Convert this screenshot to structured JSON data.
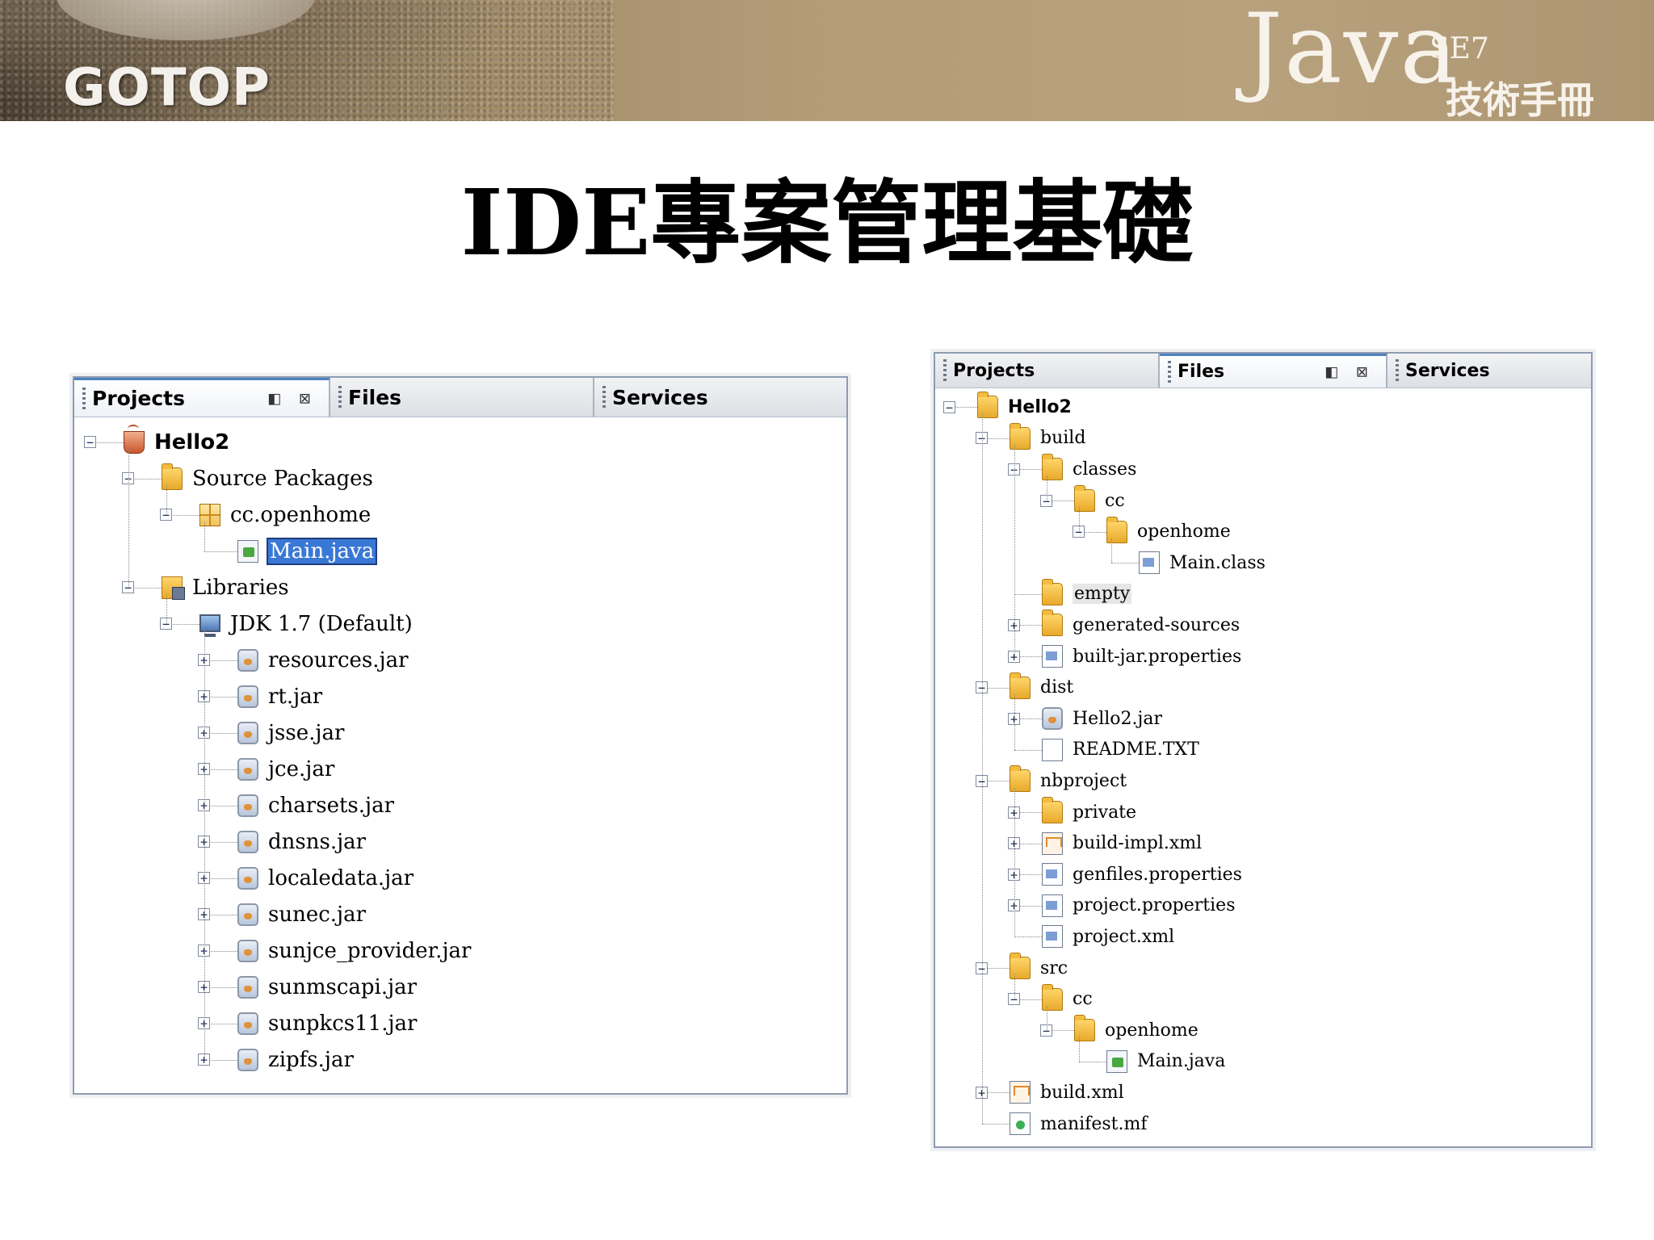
{
  "header": {
    "logo": "GOTOP",
    "java_word": "Java",
    "java_se": "SE7",
    "java_subtitle": "技術手冊"
  },
  "slide": {
    "title": "IDE專案管理基礎"
  },
  "left_panel": {
    "tabs": [
      {
        "label": "Projects",
        "active": true,
        "controls": "◧ ⊠"
      },
      {
        "label": "Files",
        "active": false
      },
      {
        "label": "Services",
        "active": false
      }
    ],
    "tree": [
      {
        "label": "Hello2",
        "icon": "java-project-icon",
        "depth": 0,
        "toggle": "-",
        "bold": true
      },
      {
        "label": "Source Packages",
        "icon": "source-packages-icon",
        "depth": 1,
        "toggle": "-"
      },
      {
        "label": "cc.openhome",
        "icon": "package-icon",
        "depth": 2,
        "toggle": "-"
      },
      {
        "label": "Main.java",
        "icon": "java-file-icon",
        "depth": 3,
        "selected": true
      },
      {
        "label": "Libraries",
        "icon": "libraries-icon",
        "depth": 1,
        "toggle": "-"
      },
      {
        "label": "JDK 1.7 (Default)",
        "icon": "jdk-icon",
        "depth": 2,
        "toggle": "-"
      },
      {
        "label": "resources.jar",
        "icon": "jar-icon",
        "depth": 3,
        "toggle": "+"
      },
      {
        "label": "rt.jar",
        "icon": "jar-icon",
        "depth": 3,
        "toggle": "+"
      },
      {
        "label": "jsse.jar",
        "icon": "jar-icon",
        "depth": 3,
        "toggle": "+"
      },
      {
        "label": "jce.jar",
        "icon": "jar-icon",
        "depth": 3,
        "toggle": "+"
      },
      {
        "label": "charsets.jar",
        "icon": "jar-icon",
        "depth": 3,
        "toggle": "+"
      },
      {
        "label": "dnsns.jar",
        "icon": "jar-icon",
        "depth": 3,
        "toggle": "+"
      },
      {
        "label": "localedata.jar",
        "icon": "jar-icon",
        "depth": 3,
        "toggle": "+"
      },
      {
        "label": "sunec.jar",
        "icon": "jar-icon",
        "depth": 3,
        "toggle": "+"
      },
      {
        "label": "sunjce_provider.jar",
        "icon": "jar-icon",
        "depth": 3,
        "toggle": "+"
      },
      {
        "label": "sunmscapi.jar",
        "icon": "jar-icon",
        "depth": 3,
        "toggle": "+"
      },
      {
        "label": "sunpkcs11.jar",
        "icon": "jar-icon",
        "depth": 3,
        "toggle": "+"
      },
      {
        "label": "zipfs.jar",
        "icon": "jar-icon",
        "depth": 3,
        "toggle": "+"
      }
    ]
  },
  "right_panel": {
    "tabs": [
      {
        "label": "Projects",
        "active": false
      },
      {
        "label": "Files",
        "active": true,
        "controls": "◧ ⊠"
      },
      {
        "label": "Services",
        "active": false
      }
    ],
    "tree": [
      {
        "label": "Hello2",
        "icon": "folder-icon",
        "depth": 0,
        "toggle": "-",
        "bold": true
      },
      {
        "label": "build",
        "icon": "folder-icon",
        "depth": 1,
        "toggle": "-"
      },
      {
        "label": "classes",
        "icon": "folder-icon",
        "depth": 2,
        "toggle": "-"
      },
      {
        "label": "cc",
        "icon": "folder-icon",
        "depth": 3,
        "toggle": "-"
      },
      {
        "label": "openhome",
        "icon": "folder-icon",
        "depth": 4,
        "toggle": "-"
      },
      {
        "label": "Main.class",
        "icon": "class-file-icon",
        "depth": 5
      },
      {
        "label": "empty",
        "icon": "folder-icon",
        "depth": 2,
        "hilite": true
      },
      {
        "label": "generated-sources",
        "icon": "folder-icon",
        "depth": 2,
        "toggle": "+"
      },
      {
        "label": "built-jar.properties",
        "icon": "properties-file-icon",
        "depth": 2,
        "toggle": "+"
      },
      {
        "label": "dist",
        "icon": "folder-icon",
        "depth": 1,
        "toggle": "-"
      },
      {
        "label": "Hello2.jar",
        "icon": "jar-icon",
        "depth": 2,
        "toggle": "+"
      },
      {
        "label": "README.TXT",
        "icon": "text-file-icon",
        "depth": 2
      },
      {
        "label": "nbproject",
        "icon": "folder-icon",
        "depth": 1,
        "toggle": "-"
      },
      {
        "label": "private",
        "icon": "folder-icon",
        "depth": 2,
        "toggle": "+"
      },
      {
        "label": "build-impl.xml",
        "icon": "ant-xml-icon",
        "depth": 2,
        "toggle": "+"
      },
      {
        "label": "genfiles.properties",
        "icon": "properties-file-icon",
        "depth": 2,
        "toggle": "+"
      },
      {
        "label": "project.properties",
        "icon": "properties-file-icon",
        "depth": 2,
        "toggle": "+"
      },
      {
        "label": "project.xml",
        "icon": "xml-file-icon",
        "depth": 2
      },
      {
        "label": "src",
        "icon": "folder-icon",
        "depth": 1,
        "toggle": "-"
      },
      {
        "label": "cc",
        "icon": "folder-icon",
        "depth": 2,
        "toggle": "-"
      },
      {
        "label": "openhome",
        "icon": "folder-icon",
        "depth": 3,
        "toggle": "-"
      },
      {
        "label": "Main.java",
        "icon": "java-file-icon",
        "depth": 4
      },
      {
        "label": "build.xml",
        "icon": "ant-xml-icon",
        "depth": 1,
        "toggle": "+"
      },
      {
        "label": "manifest.mf",
        "icon": "manifest-file-icon",
        "depth": 1
      }
    ]
  }
}
